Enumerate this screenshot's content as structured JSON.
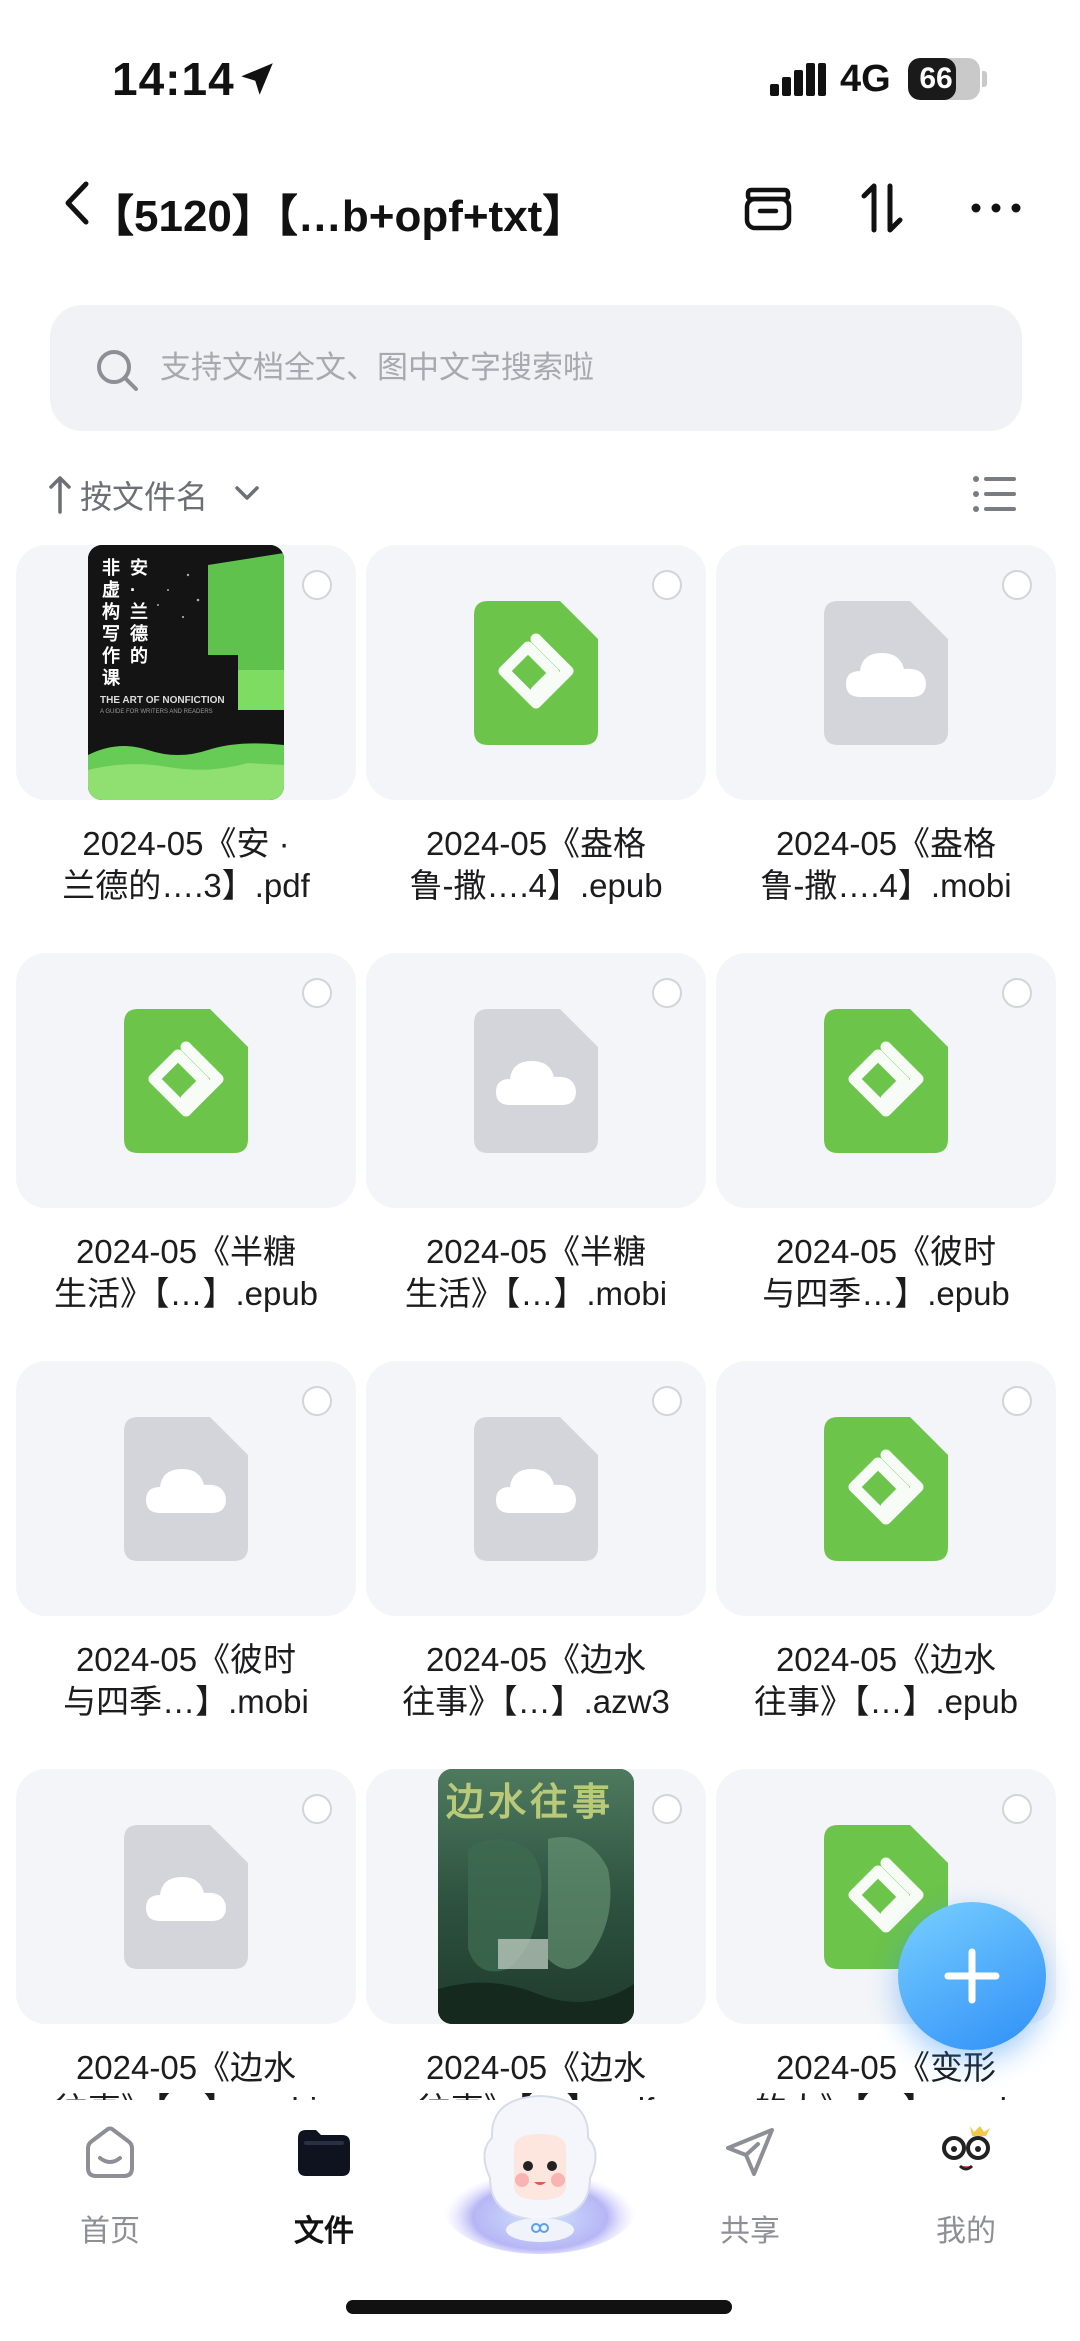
{
  "status_bar": {
    "time": "14:14",
    "network": "4G",
    "battery": "66",
    "battery_level": 0.66
  },
  "header": {
    "title": "【5120】【…b+opf+txt】",
    "icons": [
      "back-chevron-icon",
      "archive-icon",
      "sort-arrows-icon",
      "more-icon"
    ]
  },
  "search": {
    "placeholder": "支持文档全文、图中文字搜索啦"
  },
  "sort": {
    "label": "按文件名",
    "direction": "ascending"
  },
  "files": [
    {
      "line1": "2024-05《安 ·",
      "line2": "兰德的….3】.pdf",
      "type": "cover-nonfiction",
      "cover": {
        "title_v1": "安·兰德的",
        "title_v2": "非虚构写作课",
        "en": "THE ART OF NONFICTION",
        "sub": "A GUIDE FOR WRITERS AND READERS"
      }
    },
    {
      "line1": "2024-05《盎格",
      "line2": "鲁-撒….4】.epub",
      "type": "epub"
    },
    {
      "line1": "2024-05《盎格",
      "line2": "鲁-撒….4】.mobi",
      "type": "cloud"
    },
    {
      "line1": "2024-05《半糖",
      "line2": "生活》【…】.epub",
      "type": "epub"
    },
    {
      "line1": "2024-05《半糖",
      "line2": "生活》【…】.mobi",
      "type": "cloud"
    },
    {
      "line1": "2024-05《彼时",
      "line2": "与四季…】.epub",
      "type": "epub"
    },
    {
      "line1": "2024-05《彼时",
      "line2": "与四季…】.mobi",
      "type": "cloud"
    },
    {
      "line1": "2024-05《边水",
      "line2": "往事》【…】.azw3",
      "type": "cloud"
    },
    {
      "line1": "2024-05《边水",
      "line2": "往事》【…】.epub",
      "type": "epub"
    },
    {
      "line1": "2024-05《边水",
      "line2": "往事》【…】.mobi",
      "type": "cloud"
    },
    {
      "line1": "2024-05《边水",
      "line2": "往事》【…】.pdf",
      "type": "cover-bianshui",
      "cover": {
        "title": "边水往事"
      }
    },
    {
      "line1": "2024-05《变形",
      "line2": "的人》【…】.epub",
      "type": "epub"
    }
  ],
  "fab": {
    "icon": "plus-icon"
  },
  "bottom_nav": [
    {
      "label": "首页",
      "icon": "home-icon",
      "active": false
    },
    {
      "label": "文件",
      "icon": "folder-icon",
      "active": true
    },
    {
      "label": "",
      "icon": "mascot-icon",
      "active": false
    },
    {
      "label": "共享",
      "icon": "share-send-icon",
      "active": false
    },
    {
      "label": "我的",
      "icon": "profile-face-icon",
      "active": false
    }
  ],
  "colors": {
    "epub_green": "#6cc44a",
    "cloud_gray": "#d3d5db",
    "accent_blue": "#2f8ef7"
  }
}
